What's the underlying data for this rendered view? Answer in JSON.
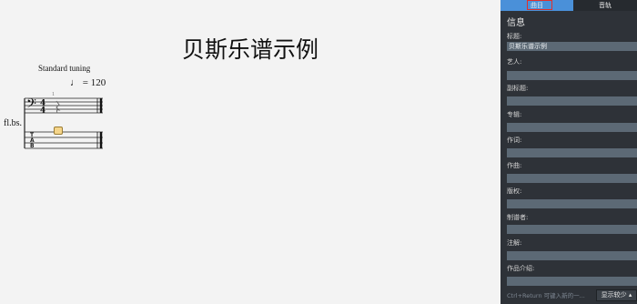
{
  "score": {
    "title": "贝斯乐谱示例",
    "tuning": "Standard tuning",
    "tempo": "♩ = 120",
    "instrument": "fl.bs.",
    "measure_number": "1",
    "time_signature": "4/4"
  },
  "panel": {
    "tabs": [
      {
        "label": "曲目"
      },
      {
        "label": "音轨"
      }
    ],
    "section_title": "信息",
    "fields": [
      {
        "label": "标题:",
        "value": "贝斯乐谱示例"
      },
      {
        "label": "艺人:",
        "value": ""
      },
      {
        "label": "副标题:",
        "value": ""
      },
      {
        "label": "专辑:",
        "value": ""
      },
      {
        "label": "作词:",
        "value": ""
      },
      {
        "label": "作曲:",
        "value": ""
      },
      {
        "label": "版权:",
        "value": ""
      },
      {
        "label": "制谱者:",
        "value": ""
      },
      {
        "label": "注解:",
        "value": ""
      },
      {
        "label": "作品介绍:",
        "value": ""
      }
    ],
    "hint": "Ctrl+Return 可键入新的一...",
    "toggle_label": "显示较少 ▴"
  },
  "colors": {
    "panel_bg": "#2e3238",
    "active_tab": "#4a90d9",
    "field_bg": "#5c6975",
    "highlight_outline": "#e0302c"
  }
}
